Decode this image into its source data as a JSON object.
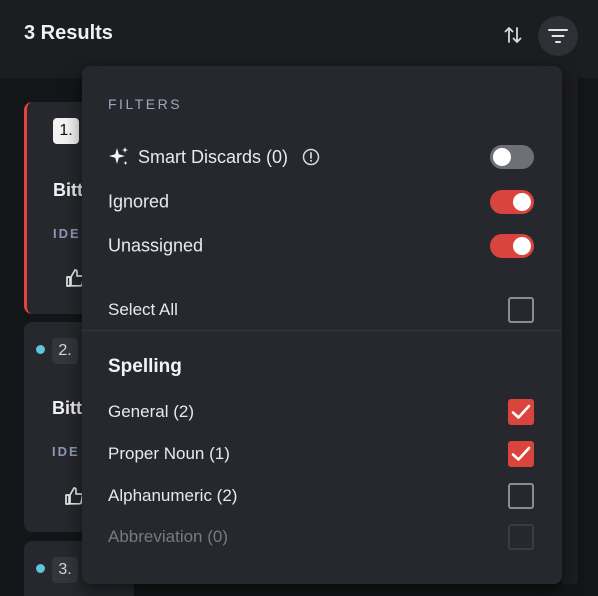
{
  "header": {
    "results_label": "3 Results",
    "sort_icon": "sort-arrows-icon",
    "filter_icon": "filter-icon"
  },
  "cards": [
    {
      "number": "1.",
      "word": "Bitt",
      "label": "IDE",
      "active": true,
      "accent": "#e0443d"
    },
    {
      "number": "2.",
      "word": "Bitt",
      "label": "IDE",
      "active": false,
      "dot_color": "#5fc4dc"
    },
    {
      "number": "3.",
      "active": false,
      "dot_color": "#5fc4dc"
    }
  ],
  "filters": {
    "heading": "FILTERS",
    "toggles": [
      {
        "label": "Smart Discards (0)",
        "on": false,
        "icon": "sparkle-icon",
        "info_icon": "info-icon"
      },
      {
        "label": "Ignored",
        "on": true
      },
      {
        "label": "Unassigned",
        "on": true
      }
    ],
    "select_all": {
      "label": "Select All",
      "checked": false
    },
    "section": {
      "title": "Spelling",
      "items": [
        {
          "label": "General (2)",
          "checked": true,
          "disabled": false
        },
        {
          "label": "Proper Noun (1)",
          "checked": true,
          "disabled": false
        },
        {
          "label": "Alphanumeric (2)",
          "checked": false,
          "disabled": false
        },
        {
          "label": "Abbreviation (0)",
          "checked": false,
          "disabled": true
        }
      ]
    }
  },
  "colors": {
    "accent": "#d9453d",
    "background": "#141518",
    "panel": "#26282d"
  }
}
